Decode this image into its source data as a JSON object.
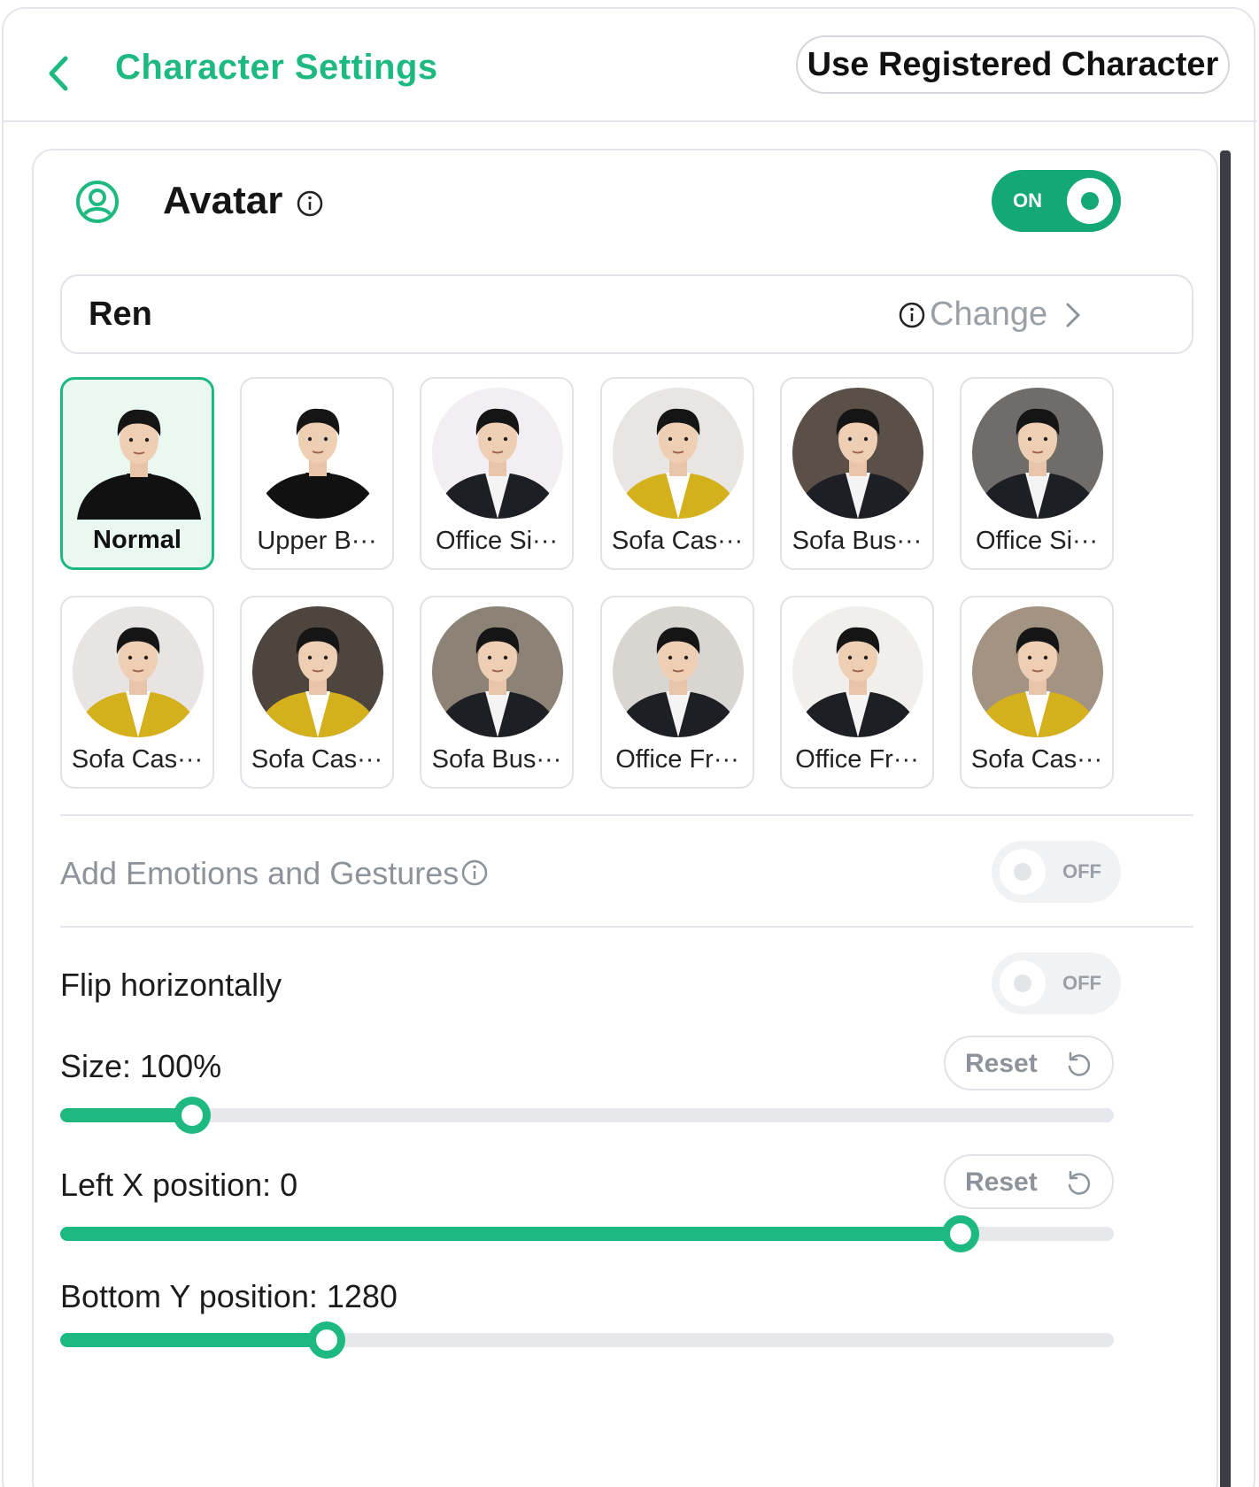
{
  "header": {
    "title": "Character Settings",
    "use_registered_label": "Use Registered Character"
  },
  "avatar_section": {
    "title": "Avatar",
    "toggle_label": "ON",
    "toggle_on": true,
    "character": {
      "name": "Ren",
      "change_label": "Change"
    },
    "poses": [
      {
        "label": "Normal",
        "selected": true,
        "background": "#eaf8f2",
        "outfit": "black-turtleneck"
      },
      {
        "label": "Upper B···",
        "selected": false,
        "background": "#ffffff",
        "outfit": "black-turtleneck"
      },
      {
        "label": "Office Si···",
        "selected": false,
        "background": "#f3eef2",
        "outfit": "suit"
      },
      {
        "label": "Sofa Cas···",
        "selected": false,
        "background": "#e8e6e2",
        "outfit": "yellow-cardigan"
      },
      {
        "label": "Sofa Bus···",
        "selected": false,
        "background": "#5a5048",
        "outfit": "suit"
      },
      {
        "label": "Office Si···",
        "selected": false,
        "background": "#6f6c6a",
        "outfit": "suit"
      },
      {
        "label": "Sofa Cas···",
        "selected": false,
        "background": "#e7e4e3",
        "outfit": "yellow-cardigan"
      },
      {
        "label": "Sofa Cas···",
        "selected": false,
        "background": "#4e463e",
        "outfit": "yellow-cardigan"
      },
      {
        "label": "Sofa Bus···",
        "selected": false,
        "background": "#8c8276",
        "outfit": "suit"
      },
      {
        "label": "Office Fr···",
        "selected": false,
        "background": "#d9d6d2",
        "outfit": "suit"
      },
      {
        "label": "Office Fr···",
        "selected": false,
        "background": "#f0efec",
        "outfit": "suit"
      },
      {
        "label": "Sofa Cas···",
        "selected": false,
        "background": "#a39382",
        "outfit": "yellow-cardigan"
      }
    ],
    "emotions": {
      "label": "Add Emotions and Gestures",
      "toggle_label": "OFF",
      "toggle_on": false
    },
    "flip": {
      "label": "Flip horizontally",
      "toggle_label": "OFF",
      "toggle_on": false
    },
    "size": {
      "label": "Size: 100%",
      "reset_label": "Reset",
      "fraction": 0.125
    },
    "left_x": {
      "label": "Left X position: 0",
      "reset_label": "Reset",
      "fraction": 0.855
    },
    "bottom_y": {
      "label": "Bottom Y position: 1280",
      "fraction": 0.253
    }
  },
  "colors": {
    "accent": "#1db981",
    "toggle_on": "#14a877",
    "muted_text": "#8d939b",
    "border": "#dfe2e6"
  },
  "icons": {
    "back": "chevron-left-icon",
    "avatar": "user-circle-icon",
    "info": "info-icon",
    "change": "chevron-right-icon",
    "reset": "undo-icon"
  }
}
